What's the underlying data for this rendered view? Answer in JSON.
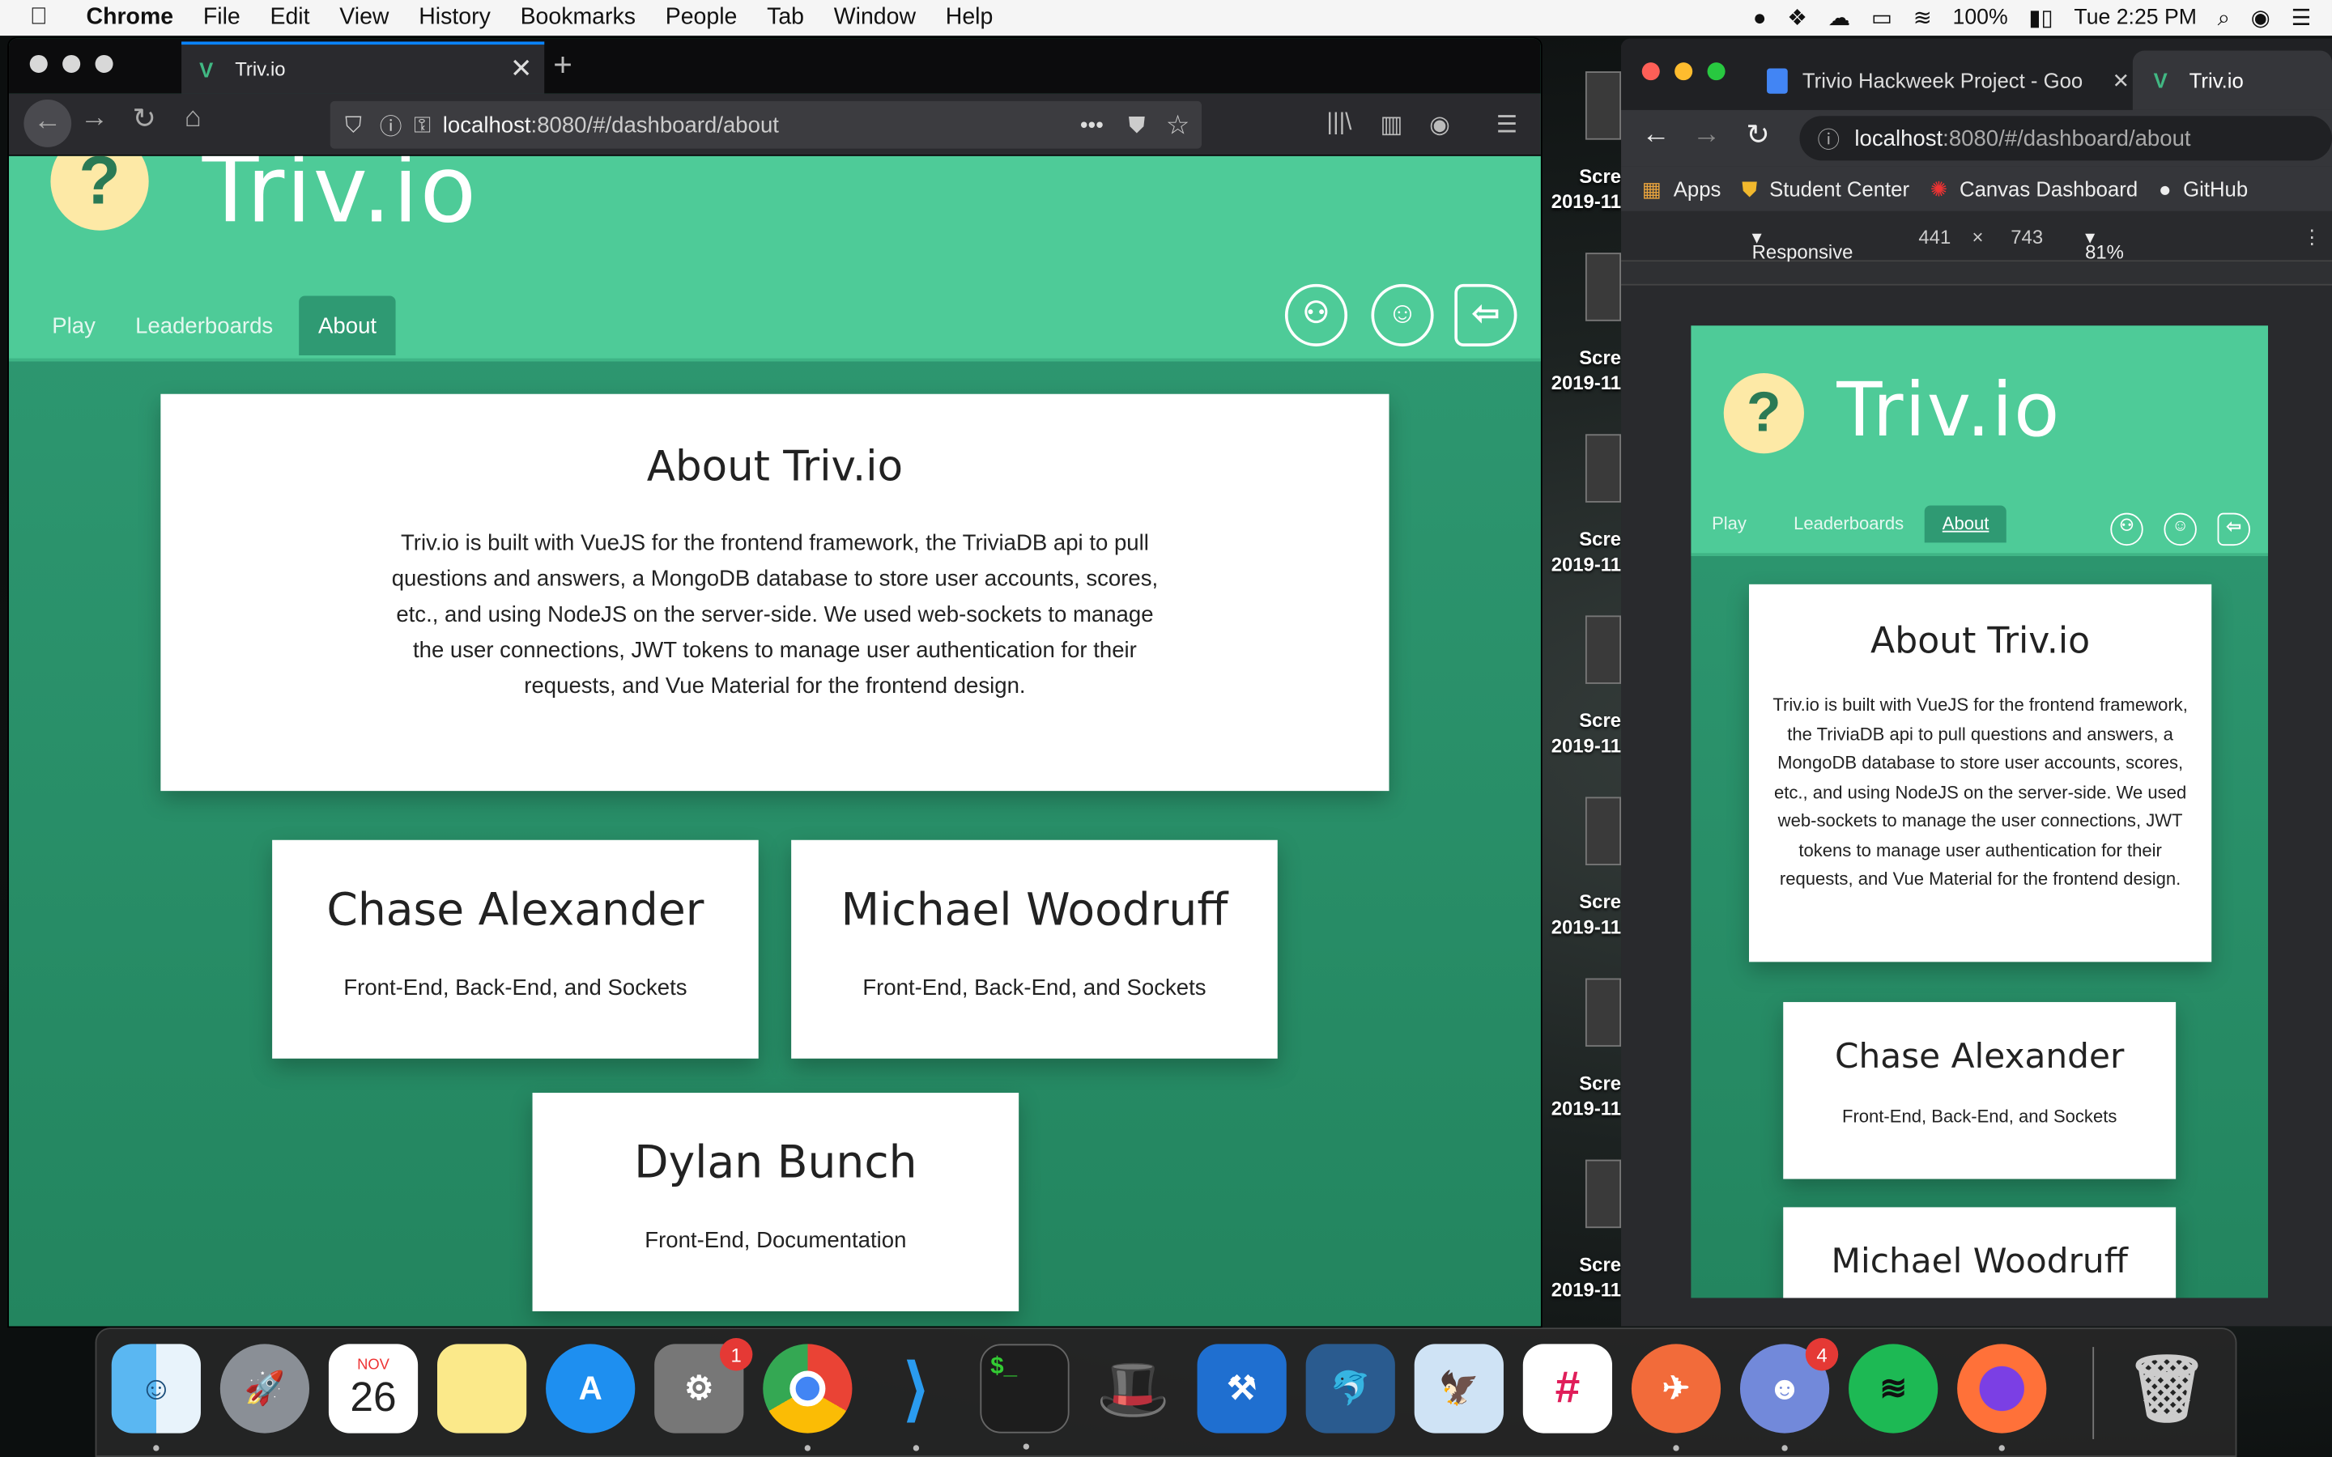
{
  "menubar": {
    "app": "Chrome",
    "items": [
      "File",
      "Edit",
      "View",
      "History",
      "Bookmarks",
      "People",
      "Tab",
      "Window",
      "Help"
    ],
    "battery": "100%",
    "clock": "Tue 2:25 PM"
  },
  "firefox": {
    "tab_title": "Triv.io",
    "tab_close": "✕",
    "new_tab": "+",
    "url_host": "localhost",
    "url_path": ":8080/#/dashboard/about",
    "page_actions": "•••"
  },
  "chrome": {
    "tab1_title": "Trivio Hackweek Project - Goo",
    "tab1_close": "✕",
    "tab2_title": "Triv.io",
    "url_host": "localhost",
    "url_path": ":8080/#/dashboard/about",
    "bookmarks": [
      "Apps",
      "Student Center",
      "Canvas Dashboard",
      "GitHub"
    ],
    "device_toolbar": {
      "mode": "Responsive",
      "width": "441",
      "times": "×",
      "height": "743",
      "zoom": "81%"
    }
  },
  "site": {
    "brand": "Triv.io",
    "logo_symbol": "?",
    "nav": [
      "Play",
      "Leaderboards",
      "About"
    ],
    "active_nav": "About",
    "about": {
      "title": "About Triv.io",
      "body": "Triv.io is built with VueJS for the frontend framework, the TriviaDB api to pull questions and answers, a MongoDB database to store user accounts, scores, etc., and using NodeJS on the server-side. We used web-sockets to manage the user connections, JWT tokens to manage user authentication for their requests, and Vue Material for the frontend design."
    },
    "team": [
      {
        "name": "Chase Alexander",
        "role": "Front-End, Back-End, and Sockets"
      },
      {
        "name": "Michael Woodruff",
        "role": "Front-End, Back-End, and Sockets"
      },
      {
        "name": "Dylan Bunch",
        "role": "Front-End, Documentation"
      }
    ]
  },
  "desktop": {
    "icon_label_top": "Scre",
    "icon_label_bottom": "2019-11"
  },
  "dock": {
    "apps": [
      "finder",
      "launchpad",
      "calendar",
      "notes",
      "app-store",
      "system-preferences",
      "chrome",
      "vscode",
      "terminal",
      "alfred",
      "xcode",
      "mysql-workbench",
      "preview",
      "slack",
      "postman",
      "discord",
      "spotify",
      "firefox",
      "trash"
    ],
    "calendar_month": "NOV",
    "calendar_day": "26",
    "badge_system_preferences": "1",
    "badge_discord": "4"
  },
  "colors": {
    "header_green": "#4ecb98",
    "body_green": "#2a8a67",
    "accent_blue": "#0a84ff"
  }
}
